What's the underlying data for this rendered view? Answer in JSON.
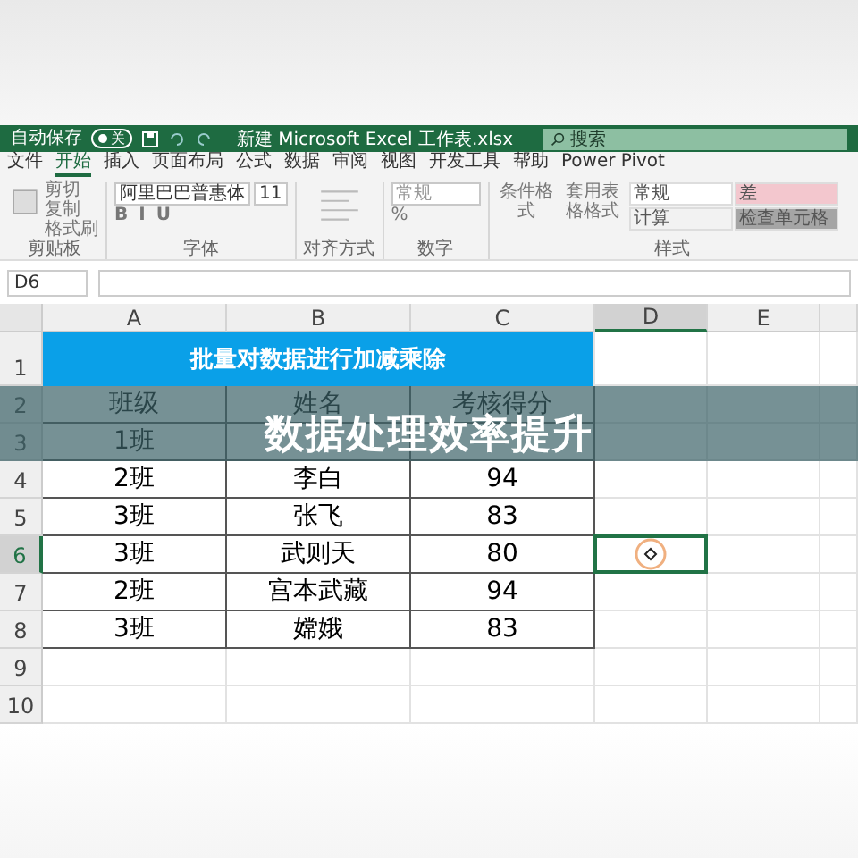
{
  "title_bar": {
    "autosave_label": "自动保存",
    "autosave_on": false,
    "autosave_state": "关",
    "file_title": "新建 Microsoft Excel 工作表.xlsx",
    "search_placeholder": "搜索"
  },
  "menu_tabs": [
    {
      "label": "文件",
      "selected": false
    },
    {
      "label": "开始",
      "selected": true
    },
    {
      "label": "插入",
      "selected": false
    },
    {
      "label": "页面布局",
      "selected": false
    },
    {
      "label": "公式",
      "selected": false
    },
    {
      "label": "数据",
      "selected": false
    },
    {
      "label": "审阅",
      "selected": false
    },
    {
      "label": "视图",
      "selected": false
    },
    {
      "label": "开发工具",
      "selected": false
    },
    {
      "label": "帮助",
      "selected": false
    },
    {
      "label": "Power Pivot",
      "selected": false
    }
  ],
  "ribbon": {
    "clipboard": {
      "label": "剪贴板",
      "items": [
        "剪切",
        "复制",
        "格式刷"
      ]
    },
    "font": {
      "label": "字体",
      "font_name": "阿里巴巴普惠体",
      "font_size": "11",
      "styles": [
        "B",
        "I",
        "U"
      ]
    },
    "alignment": {
      "label": "对齐方式"
    },
    "number": {
      "label": "数字",
      "format": "常规",
      "percent": "%"
    },
    "styles": {
      "label": "样式",
      "buttons": [
        "条件格式",
        "套用表格格式"
      ],
      "cells": [
        {
          "label": "常规",
          "color": "#ffffff"
        },
        {
          "label": "差",
          "color": "#f3c7ce"
        },
        {
          "label": "计算",
          "color": "#f2f2f2"
        },
        {
          "label": "检查单元格",
          "color": "#a5a5a5"
        }
      ]
    }
  },
  "formula_bar": {
    "name_box": "D6"
  },
  "sheet": {
    "columns": [
      {
        "label": "A",
        "selected": false
      },
      {
        "label": "B",
        "selected": false
      },
      {
        "label": "C",
        "selected": false
      },
      {
        "label": "D",
        "selected": true
      },
      {
        "label": "E",
        "selected": false
      }
    ],
    "rows": [
      {
        "label": "1",
        "selected": false
      },
      {
        "label": "2",
        "selected": false
      },
      {
        "label": "3",
        "selected": false
      },
      {
        "label": "4",
        "selected": false
      },
      {
        "label": "5",
        "selected": false
      },
      {
        "label": "6",
        "selected": true
      },
      {
        "label": "7",
        "selected": false
      },
      {
        "label": "8",
        "selected": false
      },
      {
        "label": "9",
        "selected": false
      },
      {
        "label": "10",
        "selected": false
      }
    ],
    "title": "批量对数据进行加减乘除",
    "data": [
      [
        "班级",
        "姓名",
        "考核得分"
      ],
      [
        "1班"
      ],
      [
        "2班",
        "李白",
        "94"
      ],
      [
        "3班",
        "张飞",
        "83"
      ],
      [
        "3班",
        "武则天",
        "80"
      ],
      [
        "2班",
        "宫本武藏",
        "94"
      ],
      [
        "3班",
        "嫦娥",
        "83"
      ]
    ]
  },
  "banner": {
    "text": "数据处理效率提升"
  }
}
